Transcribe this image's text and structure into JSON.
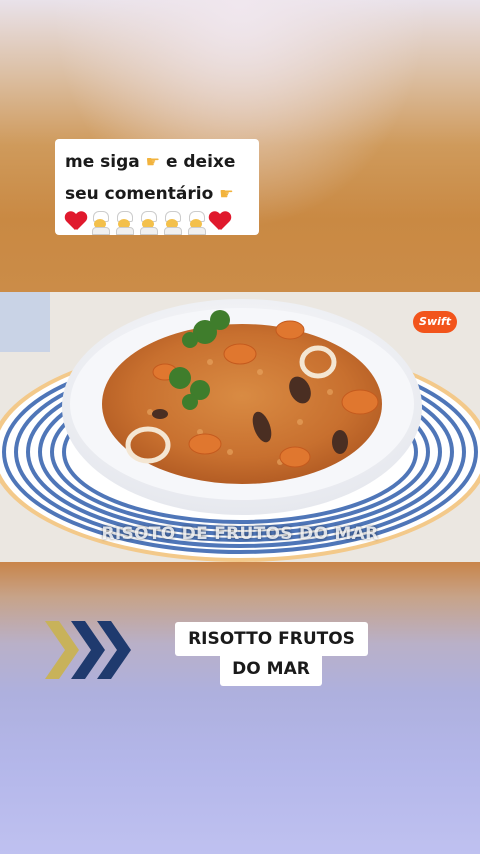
{
  "overlay_caption": {
    "line1": "me siga 👈 e deixe",
    "line1_text": "me siga",
    "line1_after": "e deixe",
    "line2_text": "seu comentário",
    "emoji_row": [
      "heart",
      "chef",
      "chef",
      "chef",
      "chef",
      "chef",
      "heart"
    ]
  },
  "video": {
    "brand_badge": "Swift",
    "burned_caption": "RISOTO DE FRUTOS DO MAR"
  },
  "title_card": {
    "line1": "RISOTTO FRUTOS",
    "line2": "DO MAR"
  },
  "colors": {
    "chevron_1": "#c8b25a",
    "chevron_2": "#1f3a6e",
    "chevron_3": "#1f3a6e",
    "badge": "#f2541b",
    "heart": "#e0192d"
  }
}
